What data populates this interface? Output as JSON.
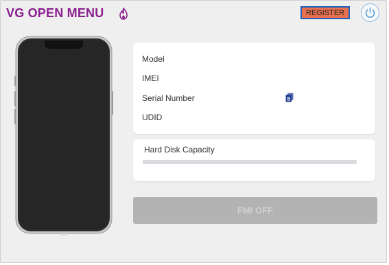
{
  "app": {
    "title": "VG OPEN MENU"
  },
  "header": {
    "register_label": "REGISTER"
  },
  "device_info": {
    "model_label": "Model",
    "imei_label": "IMEI",
    "serial_label": "Serial Number",
    "udid_label": "UDID"
  },
  "disk": {
    "label": "Hard Disk Capacity",
    "used_fraction": 0
  },
  "actions": {
    "fmi_off_label": "FMI OFF"
  },
  "icons": {
    "flame": "flame-icon",
    "power": "power-icon",
    "copy": "copy-icon",
    "phone": "phone-illustration"
  },
  "colors": {
    "title": "#8a1f8f",
    "register_bg": "#e8704e",
    "register_border": "#1f5fbf",
    "power_accent": "#5aa0d8",
    "copy_icon": "#1f3f8f",
    "fmi_disabled_bg": "#b3b3b3"
  }
}
